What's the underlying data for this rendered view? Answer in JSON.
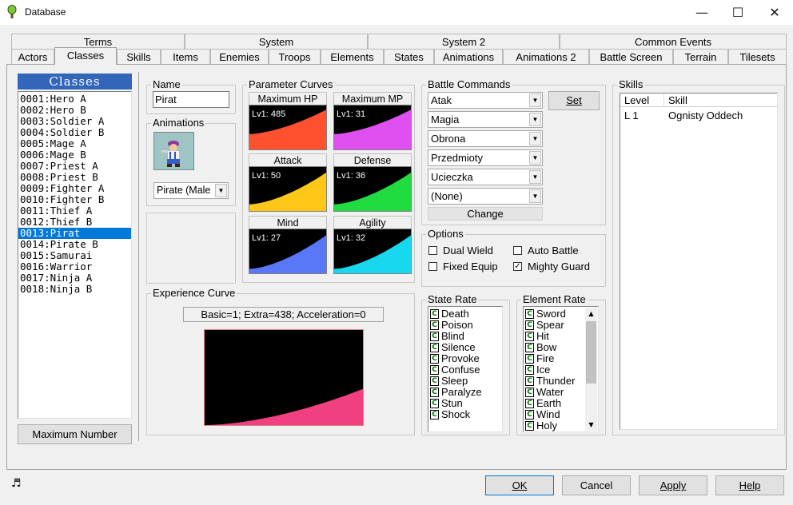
{
  "window": {
    "title": "Database",
    "minimize": "—",
    "maximize": "☐",
    "close": "✕"
  },
  "tabs_row1": [
    "Terms",
    "System",
    "System 2",
    "Common Events"
  ],
  "tabs_row2": [
    "Actors",
    "Classes",
    "Skills",
    "Items",
    "Enemies",
    "Troops",
    "Elements",
    "States",
    "Animations",
    "Animations 2",
    "Battle Screen",
    "Terrain",
    "Tilesets"
  ],
  "classes": {
    "header": "Classes",
    "items": [
      "0001:Hero A",
      "0002:Hero B",
      "0003:Soldier A",
      "0004:Soldier B",
      "0005:Mage A",
      "0006:Mage B",
      "0007:Priest A",
      "0008:Priest B",
      "0009:Fighter A",
      "0010:Fighter B",
      "0011:Thief A",
      "0012:Thief B",
      "0013:Pirat",
      "0014:Pirate B",
      "0015:Samurai",
      "0016:Warrior",
      "0017:Ninja A",
      "0018:Ninja B"
    ],
    "selected_index": 12,
    "max_button": "Maximum Number"
  },
  "name": {
    "label": "Name",
    "value": "Pirat"
  },
  "animations": {
    "label": "Animations",
    "value": "Pirate (Male"
  },
  "parameter_curves": {
    "label": "Parameter Curves",
    "curves": [
      {
        "title": "Maximum HP",
        "value": "Lv1: 485",
        "color": "#ff5030",
        "start": 0.35
      },
      {
        "title": "Maximum MP",
        "value": "Lv1: 31",
        "color": "#e050f0",
        "start": 0.35
      },
      {
        "title": "Attack",
        "value": "Lv1: 50",
        "color": "#ffc818",
        "start": 0.15
      },
      {
        "title": "Defense",
        "value": "Lv1: 36",
        "color": "#20dc40",
        "start": 0.15
      },
      {
        "title": "Mind",
        "value": "Lv1: 27",
        "color": "#5878f8",
        "start": 0.1
      },
      {
        "title": "Agility",
        "value": "Lv1: 32",
        "color": "#18d8f0",
        "start": 0.1
      }
    ]
  },
  "experience": {
    "label": "Experience Curve",
    "formula": "Basic=1; Extra=438; Acceleration=0",
    "color": "#f04080"
  },
  "battle_commands": {
    "label": "Battle Commands",
    "commands": [
      "Atak",
      "Magia",
      "Obrona",
      "Przedmioty",
      "Ucieczka",
      "(None)"
    ],
    "set": "Set",
    "change": "Change"
  },
  "options": {
    "label": "Options",
    "dual_wield": {
      "label": "Dual Wield",
      "checked": false
    },
    "auto_battle": {
      "label": "Auto Battle",
      "checked": false
    },
    "fixed_equip": {
      "label": "Fixed Equip",
      "checked": false
    },
    "mighty_guard": {
      "label": "Mighty Guard",
      "checked": true
    }
  },
  "state_rate": {
    "label": "State Rate",
    "rate": "C",
    "items": [
      "Death",
      "Poison",
      "Blind",
      "Silence",
      "Provoke",
      "Confuse",
      "Sleep",
      "Paralyze",
      "Stun",
      "Shock"
    ]
  },
  "element_rate": {
    "label": "Element Rate",
    "rate": "C",
    "items": [
      "Sword",
      "Spear",
      "Hit",
      "Bow",
      "Fire",
      "Ice",
      "Thunder",
      "Water",
      "Earth",
      "Wind",
      "Holy"
    ]
  },
  "skills": {
    "label": "Skills",
    "col_level": "Level",
    "col_skill": "Skill",
    "rows": [
      {
        "level": "L 1",
        "skill": "Ognisty Oddech"
      }
    ]
  },
  "footer": {
    "ok": "OK",
    "cancel": "Cancel",
    "apply": "Apply",
    "help": "Help",
    "music_icon": "♬"
  }
}
